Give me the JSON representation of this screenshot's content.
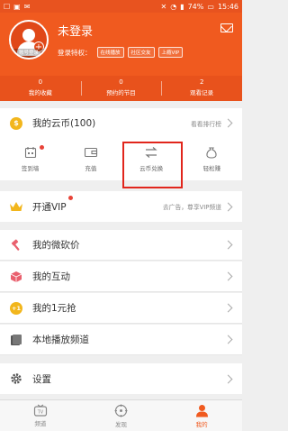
{
  "status_bar": {
    "battery": "74%",
    "time": "15:46"
  },
  "header": {
    "user_name": "未登录",
    "avatar_caption": "账号登录",
    "privilege_label": "登录特权：",
    "privilege_tags": [
      "在线播放",
      "社区交友",
      "上瘾VIP"
    ]
  },
  "stats": [
    {
      "value": "0",
      "label": "我的收藏"
    },
    {
      "value": "0",
      "label": "预约的节目"
    },
    {
      "value": "2",
      "label": "观看记录"
    }
  ],
  "coins": {
    "label": "我的云币(100)",
    "side": "看看排行榜"
  },
  "coin_actions": [
    {
      "label": "签到墙"
    },
    {
      "label": "充值"
    },
    {
      "label": "云币兑换"
    },
    {
      "label": "轻松赚"
    }
  ],
  "vip": {
    "label": "开通VIP",
    "side": "去广告，尊享VIP频道"
  },
  "menu": [
    {
      "label": "我的微砍价"
    },
    {
      "label": "我的互动"
    },
    {
      "label": "我的1元抢"
    },
    {
      "label": "本地播放频道"
    },
    {
      "label": "设置"
    }
  ],
  "tabs": [
    {
      "label": "频道"
    },
    {
      "label": "发现"
    },
    {
      "label": "我的"
    }
  ],
  "colors": {
    "brand": "#f05a1f",
    "highlight": "#e1261c",
    "coin": "#f2b61c"
  }
}
